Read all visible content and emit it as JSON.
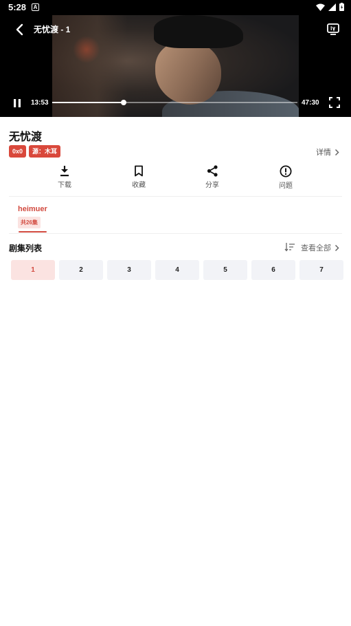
{
  "status_bar": {
    "time": "5:28",
    "notification_letter": "A"
  },
  "player": {
    "title": "无忧渡 - 1",
    "current_time": "13:53",
    "total_time": "47:30",
    "progress_fraction": 0.29
  },
  "show": {
    "title": "无忧渡",
    "badges": [
      "0x0",
      "源：木耳"
    ],
    "details_label": "详情"
  },
  "actions": [
    {
      "label": "下载",
      "icon": "download-icon"
    },
    {
      "label": "收藏",
      "icon": "bookmark-icon"
    },
    {
      "label": "分享",
      "icon": "share-icon"
    },
    {
      "label": "问题",
      "icon": "alert-icon"
    }
  ],
  "source": {
    "name": "heimuer",
    "count": "共26集"
  },
  "episode_list": {
    "header": "剧集列表",
    "view_all": "查看全部",
    "episodes": [
      "1",
      "2",
      "3",
      "4",
      "5",
      "6",
      "7"
    ],
    "active_index": 0
  },
  "colors": {
    "accent": "#d24a3f",
    "badge": "#d9483b",
    "episode_bg": "#f2f3f7",
    "episode_active_bg": "#fbe3e1"
  }
}
